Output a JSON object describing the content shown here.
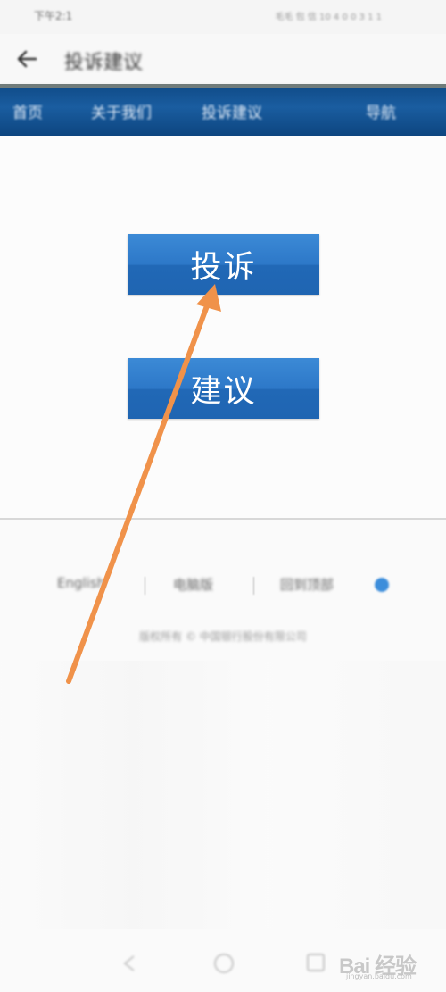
{
  "status_bar": {
    "left_text": "下午2:1",
    "right_text": "毛毛 包 信 10 4 0 0 3 1 1"
  },
  "header": {
    "title": "投诉建议"
  },
  "nav_strip": {
    "items": [
      "首页",
      "关于我们",
      "投诉建议",
      "导航"
    ]
  },
  "main": {
    "complaint_label": "投诉",
    "suggestion_label": "建议"
  },
  "footer": {
    "links": [
      "English",
      "电脑版",
      "回到顶部"
    ],
    "copyright": "版权所有 © 中国银行股份有限公司"
  },
  "watermark": {
    "text": "Bai 经验",
    "sub": "jingyan.baidu.com"
  },
  "colors": {
    "nav_blue": "#1a5da0",
    "button_blue": "#2d78c8",
    "arrow_orange": "#f0924a"
  }
}
